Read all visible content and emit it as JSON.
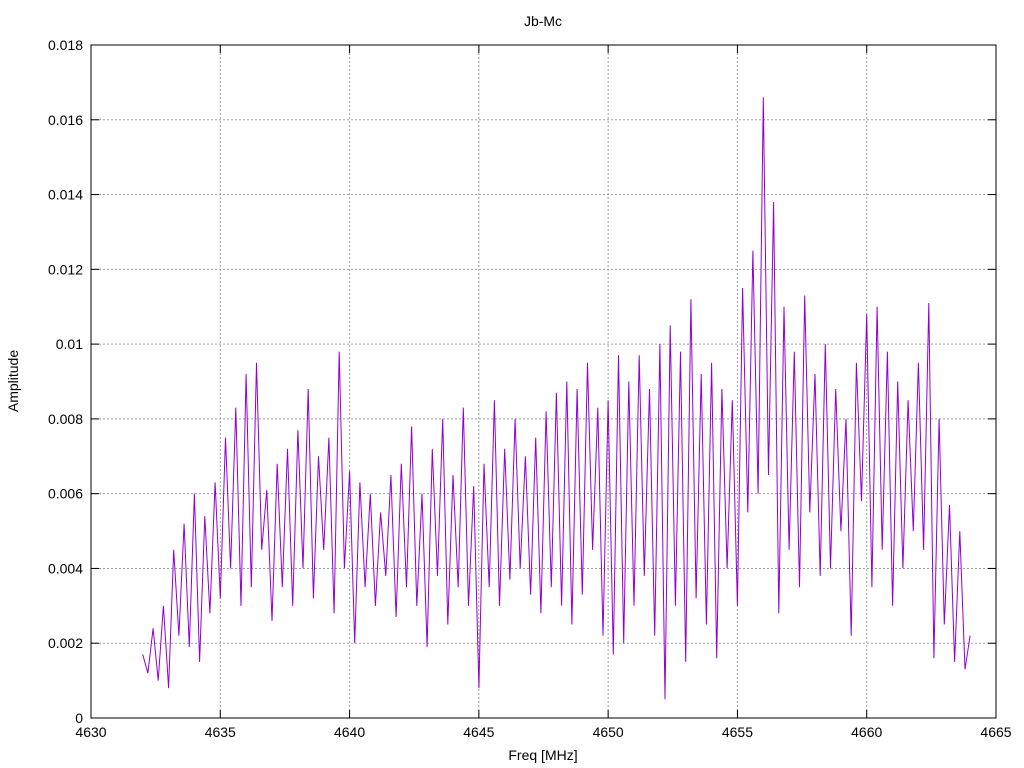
{
  "chart_data": {
    "type": "line",
    "title": "Jb-Mc",
    "xlabel": "Freq [MHz]",
    "ylabel": "Amplitude",
    "xlim": [
      4630,
      4665
    ],
    "ylim": [
      0,
      0.018
    ],
    "grid": true,
    "x_ticks": [
      4630,
      4635,
      4640,
      4645,
      4650,
      4655,
      4660,
      4665
    ],
    "x_tick_labels": [
      "4630",
      "4635",
      "4640",
      "4645",
      "4650",
      "4655",
      "4660",
      "4665"
    ],
    "y_ticks": [
      0,
      0.002,
      0.004,
      0.006,
      0.008,
      0.01,
      0.012,
      0.014,
      0.016,
      0.018
    ],
    "y_tick_labels": [
      "0",
      "0.002",
      "0.004",
      "0.006",
      "0.008",
      "0.01",
      "0.012",
      "0.014",
      "0.016",
      "0.018"
    ],
    "series": [
      {
        "name": "Jb-Mc",
        "color": "#9400d3",
        "x_start": 4632.0,
        "x_step": 0.2,
        "values": [
          0.0017,
          0.0012,
          0.0024,
          0.001,
          0.003,
          0.0008,
          0.0045,
          0.0022,
          0.0052,
          0.0019,
          0.006,
          0.0015,
          0.0054,
          0.0028,
          0.0063,
          0.0032,
          0.0075,
          0.004,
          0.0083,
          0.003,
          0.0092,
          0.0035,
          0.0095,
          0.0045,
          0.0061,
          0.0026,
          0.0068,
          0.0035,
          0.0072,
          0.003,
          0.0077,
          0.004,
          0.0088,
          0.0032,
          0.007,
          0.0045,
          0.0075,
          0.0028,
          0.0098,
          0.004,
          0.0066,
          0.002,
          0.0063,
          0.0035,
          0.006,
          0.003,
          0.0055,
          0.0038,
          0.0065,
          0.0027,
          0.0068,
          0.0035,
          0.0078,
          0.003,
          0.006,
          0.0019,
          0.0072,
          0.0038,
          0.008,
          0.0025,
          0.0065,
          0.0035,
          0.0083,
          0.003,
          0.0062,
          0.0008,
          0.0068,
          0.0035,
          0.0085,
          0.003,
          0.0072,
          0.0037,
          0.008,
          0.004,
          0.007,
          0.0033,
          0.0075,
          0.0028,
          0.0082,
          0.0035,
          0.0087,
          0.003,
          0.009,
          0.0025,
          0.0088,
          0.0033,
          0.0095,
          0.0045,
          0.0083,
          0.0022,
          0.0085,
          0.0017,
          0.0097,
          0.002,
          0.009,
          0.003,
          0.0097,
          0.0038,
          0.0088,
          0.0022,
          0.01,
          0.0005,
          0.0105,
          0.003,
          0.0098,
          0.0015,
          0.0112,
          0.0032,
          0.0092,
          0.0025,
          0.0095,
          0.0016,
          0.0088,
          0.004,
          0.0085,
          0.003,
          0.0115,
          0.0055,
          0.0125,
          0.006,
          0.0166,
          0.0065,
          0.0138,
          0.0028,
          0.011,
          0.0045,
          0.0098,
          0.0035,
          0.0113,
          0.0055,
          0.0092,
          0.0038,
          0.01,
          0.004,
          0.0088,
          0.005,
          0.008,
          0.0022,
          0.0095,
          0.0058,
          0.0108,
          0.0035,
          0.011,
          0.0045,
          0.0098,
          0.003,
          0.009,
          0.004,
          0.0085,
          0.005,
          0.0095,
          0.0045,
          0.0111,
          0.0016,
          0.008,
          0.0025,
          0.0057,
          0.0015,
          0.005,
          0.0013,
          0.0022
        ]
      }
    ]
  }
}
